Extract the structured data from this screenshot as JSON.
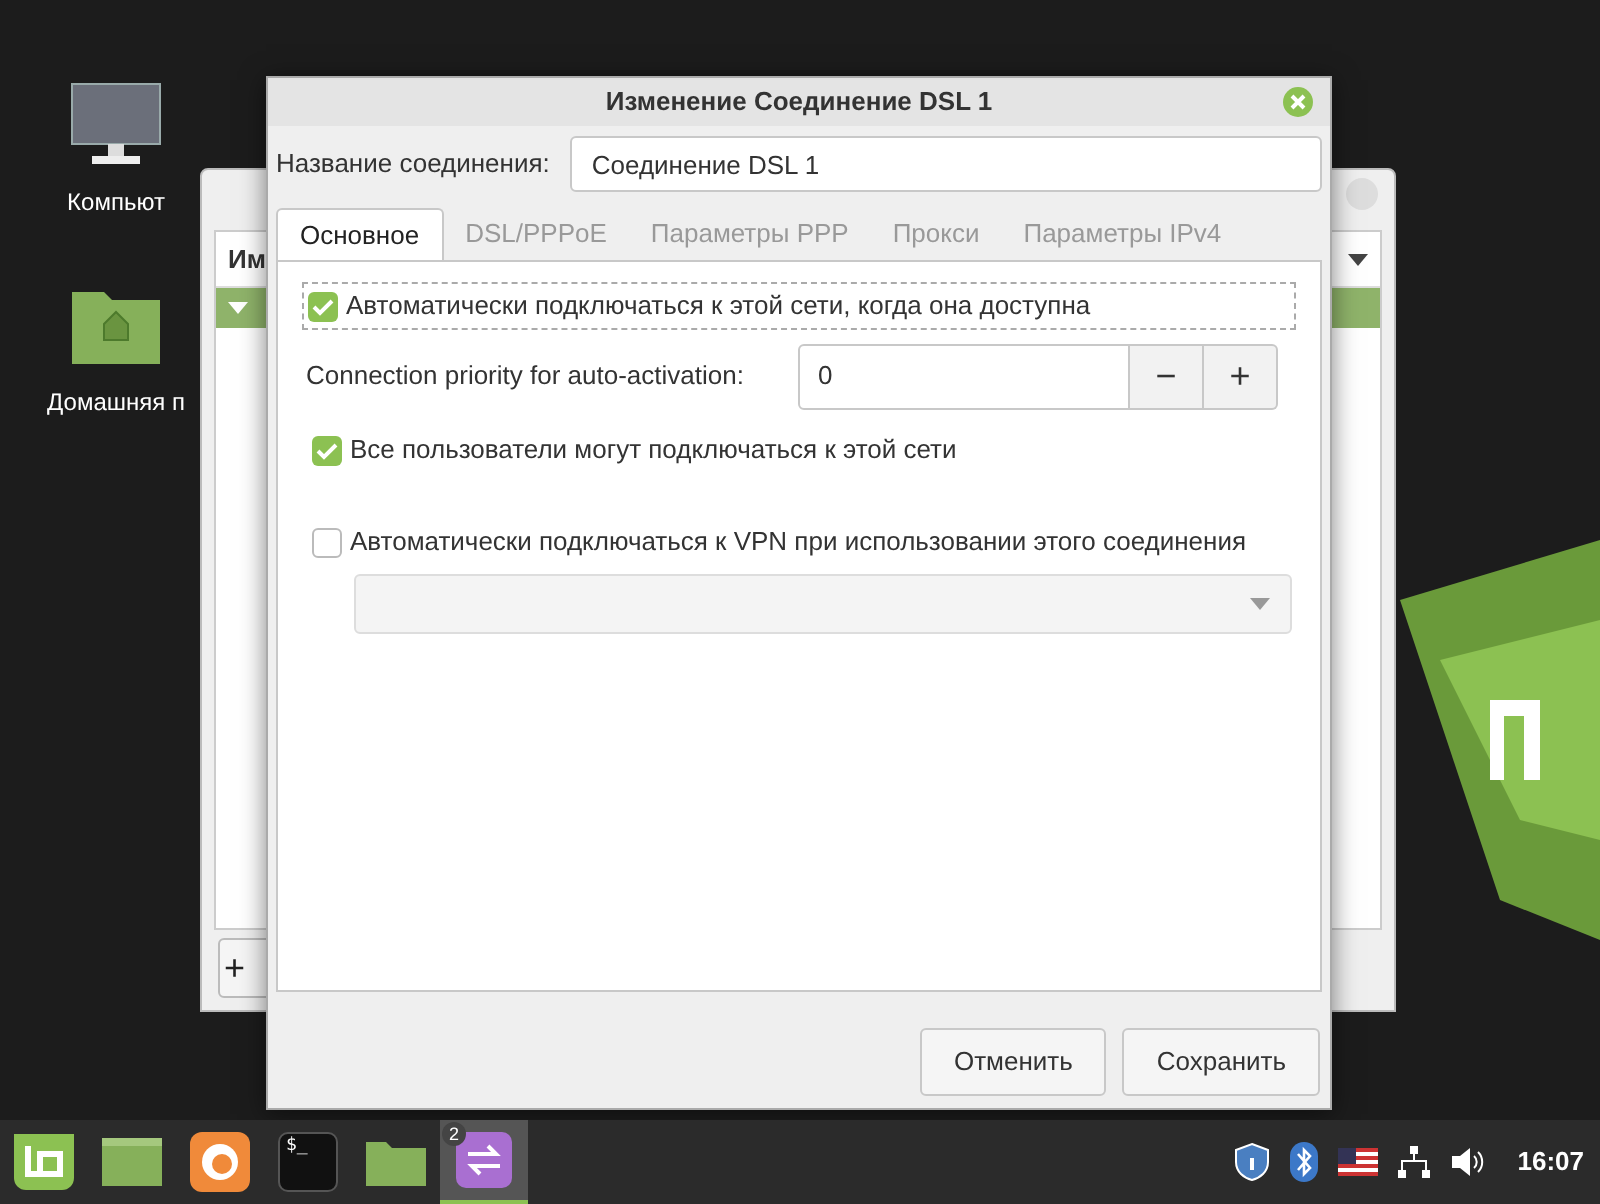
{
  "desktop_icons": [
    {
      "kind": "computer",
      "label": "Компьют"
    },
    {
      "kind": "home",
      "label": "Домашняя п"
    }
  ],
  "background_window": {
    "column_1": "Им",
    "add_button": "+",
    "rows": [
      {
        "selected": true
      }
    ]
  },
  "dialog": {
    "title": "Изменение Соединение DSL 1",
    "name_label": "Название соединения:",
    "name_value": "Соединение DSL 1",
    "tabs": [
      {
        "label": "Основное",
        "selected": true
      },
      {
        "label": "DSL/PPPoE",
        "selected": false
      },
      {
        "label": "Параметры PPP",
        "selected": false
      },
      {
        "label": "Прокси",
        "selected": false
      },
      {
        "label": "Параметры IPv4",
        "selected": false
      }
    ],
    "options": [
      {
        "kind": "checkbox",
        "label": "Автоматически подключаться к этой сети, когда она доступна",
        "checked": true,
        "focused": true
      },
      {
        "kind": "spin",
        "label": "Connection priority for auto-activation:",
        "value": "0",
        "minus": "−",
        "plus": "+"
      },
      {
        "kind": "checkbox",
        "label": "Все пользователи могут подключаться к этой сети",
        "checked": true,
        "focused": false
      },
      {
        "kind": "checkbox",
        "label": "Автоматически подключаться к VPN при использовании этого соединения",
        "checked": false,
        "focused": false
      },
      {
        "kind": "dropdown",
        "disabled": true
      }
    ],
    "buttons": [
      "Отменить",
      "Сохранить"
    ]
  },
  "taskbar": {
    "launchers": [
      {
        "kind": "menu",
        "selected": false
      },
      {
        "kind": "files-window",
        "selected": false
      },
      {
        "kind": "browser",
        "selected": false
      },
      {
        "kind": "terminal",
        "selected": false,
        "text": "$_"
      },
      {
        "kind": "folder",
        "selected": false
      },
      {
        "kind": "network",
        "selected": true,
        "badge": "2"
      }
    ],
    "tray": [
      {
        "kind": "shield"
      },
      {
        "kind": "bluetooth"
      },
      {
        "kind": "flag"
      },
      {
        "kind": "network"
      },
      {
        "kind": "volume"
      }
    ],
    "clock": "16:07"
  }
}
